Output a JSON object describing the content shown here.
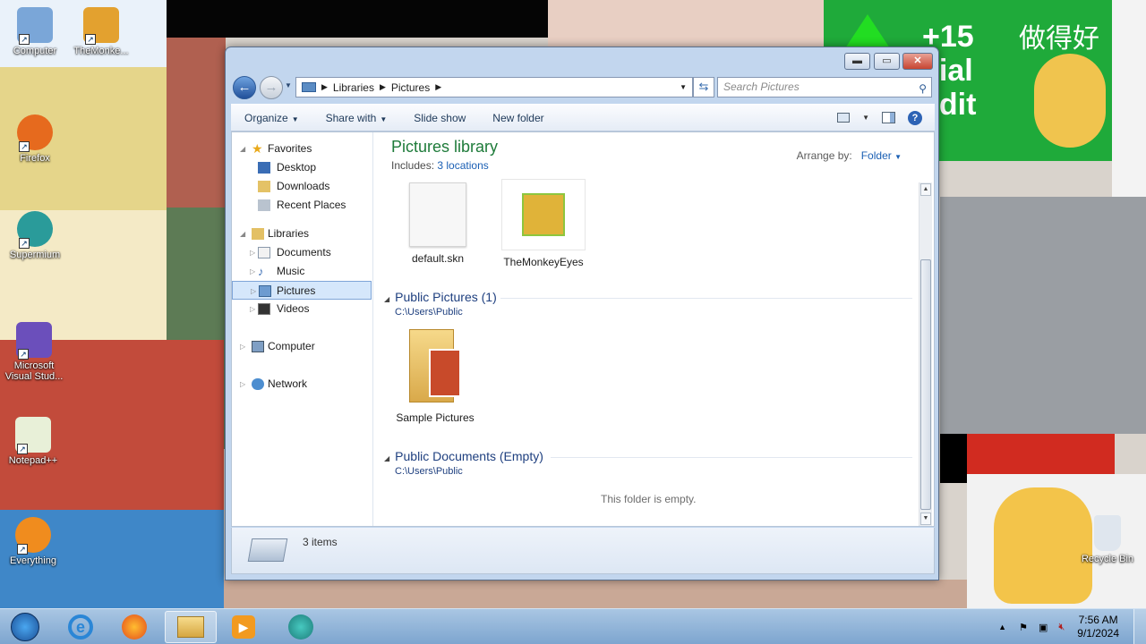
{
  "desktop": {
    "icons": [
      {
        "label": "Computer",
        "icon": "computer-icon"
      },
      {
        "label": "TheMonke...",
        "icon": "monkey-icon"
      },
      {
        "label": "Firefox",
        "icon": "firefox-icon"
      },
      {
        "label": "Supermium",
        "icon": "supermium-icon"
      },
      {
        "label": "Microsoft Visual Stud...",
        "icon": "visual-studio-icon"
      },
      {
        "label": "Notepad++",
        "icon": "notepad-icon"
      },
      {
        "label": "Everything",
        "icon": "everything-icon"
      },
      {
        "label": "Recycle Bin",
        "icon": "recycle-bin-icon"
      }
    ],
    "overlay_text": {
      "plus": "+15",
      "line1": "cial",
      "line2": "edit",
      "chinese": "做得好"
    }
  },
  "window": {
    "controls": {
      "minimize": "▬",
      "maximize": "▭",
      "close": "✕"
    },
    "breadcrumb": [
      "Libraries",
      "Pictures"
    ],
    "search_placeholder": "Search Pictures",
    "toolbar": {
      "organize": "Organize",
      "share": "Share with",
      "slideshow": "Slide show",
      "newfolder": "New folder"
    },
    "nav": {
      "favorites": "Favorites",
      "desktop": "Desktop",
      "downloads": "Downloads",
      "recent": "Recent Places",
      "libraries": "Libraries",
      "documents": "Documents",
      "music": "Music",
      "pictures": "Pictures",
      "videos": "Videos",
      "computer": "Computer",
      "network": "Network"
    },
    "library": {
      "title": "Pictures library",
      "includes": "Includes:",
      "locations": "3 locations",
      "arrange_label": "Arrange by:",
      "arrange_value": "Folder"
    },
    "files_top": [
      {
        "name": "default.skn",
        "icon": "file-icon"
      },
      {
        "name": "TheMonkeyEyes",
        "icon": "monkey-image-icon"
      }
    ],
    "groups": [
      {
        "title": "Public Pictures (1)",
        "path": "C:\\Users\\Public"
      },
      {
        "title": "Public Documents (Empty)",
        "path": "C:\\Users\\Public"
      }
    ],
    "folder_item": "Sample Pictures",
    "empty_text": "This folder is empty.",
    "status": "3 items"
  },
  "taskbar": {
    "apps": [
      "start-orb",
      "internet-explorer",
      "firefox",
      "explorer",
      "media-player",
      "supermium"
    ],
    "time": "7:56 AM",
    "date": "9/1/2024"
  }
}
